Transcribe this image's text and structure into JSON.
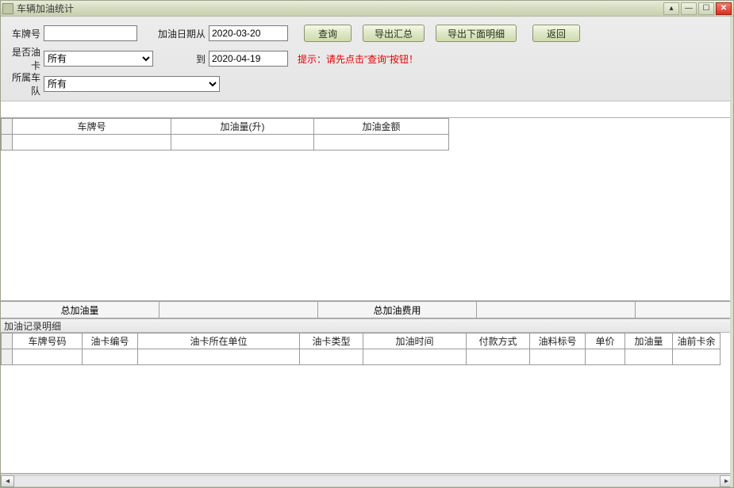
{
  "titlebar": {
    "title": "车辆加油统计"
  },
  "filters": {
    "plate_label": "车牌号",
    "plate_value": "",
    "date_from_label": "加油日期从",
    "date_from": "2020-03-20",
    "date_to_label": "到",
    "date_to": "2020-04-19",
    "fuelcard_label": "是否油卡",
    "fuelcard_value": "所有",
    "fleet_label": "所属车队",
    "fleet_value": "所有",
    "hint": "提示：请先点击”查询”按钮！"
  },
  "buttons": {
    "query": "查询",
    "export_summary": "导出汇总",
    "export_detail": "导出下面明细",
    "back": "返回"
  },
  "top_grid": {
    "cols": [
      "车牌号",
      "加油量(升)",
      "加油金额"
    ],
    "rows": [
      [
        "",
        "",
        ""
      ]
    ]
  },
  "summary": {
    "total_volume_label": "总加油量",
    "total_volume": "",
    "total_cost_label": "总加油费用",
    "total_cost": ""
  },
  "detail_section_title": "加油记录明细",
  "detail_grid": {
    "cols": [
      "车牌号码",
      "油卡编号",
      "油卡所在单位",
      "油卡类型",
      "加油时间",
      "付款方式",
      "油料标号",
      "单价",
      "加油量",
      "油前卡余"
    ],
    "rows": [
      [
        "",
        "",
        "",
        "",
        "",
        "",
        "",
        "",
        "",
        ""
      ]
    ]
  }
}
